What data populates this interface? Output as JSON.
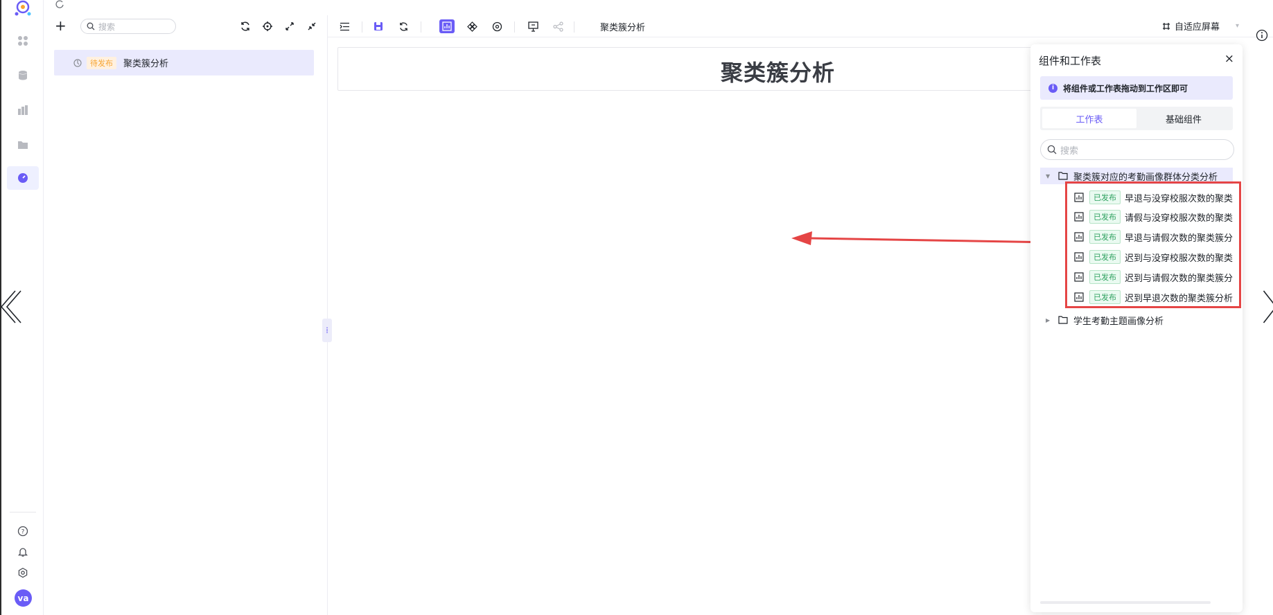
{
  "tree": {
    "search_placeholder": "搜索",
    "add_label": "+",
    "items": [
      {
        "status": "待发布",
        "label": "聚类簇分析"
      }
    ]
  },
  "toolbar": {
    "title": "聚类簇分析",
    "fit_screen": "自适应屏幕"
  },
  "canvas": {
    "title": "聚类簇分析"
  },
  "panel": {
    "title": "组件和工作表",
    "close": "×",
    "hint": "将组件或工作表拖动到工作区即可",
    "tabs": [
      {
        "label": "工作表",
        "active": true
      },
      {
        "label": "基础组件",
        "active": false
      }
    ],
    "search_placeholder": "搜索",
    "folders": [
      {
        "name": "聚类簇对应的考勤画像群体分类分析",
        "expanded": true
      },
      {
        "name": "学生考勤主题画像分析",
        "expanded": false
      }
    ],
    "worksheets": [
      {
        "status": "已发布",
        "name": "早退与没穿校服次数的聚类"
      },
      {
        "status": "已发布",
        "name": "请假与没穿校服次数的聚类"
      },
      {
        "status": "已发布",
        "name": "早退与请假次数的聚类簇分"
      },
      {
        "status": "已发布",
        "name": "迟到与没穿校服次数的聚类"
      },
      {
        "status": "已发布",
        "name": "迟到与请假次数的聚类簇分"
      },
      {
        "status": "已发布",
        "name": "迟到早退次数的聚类簇分析"
      }
    ]
  },
  "user": {
    "avatar_initials": "va"
  },
  "colors": {
    "accent": "#6a5cf6",
    "annotation_red": "#e54545",
    "published_green": "#2ea15f",
    "pending_orange": "#f7a431"
  }
}
